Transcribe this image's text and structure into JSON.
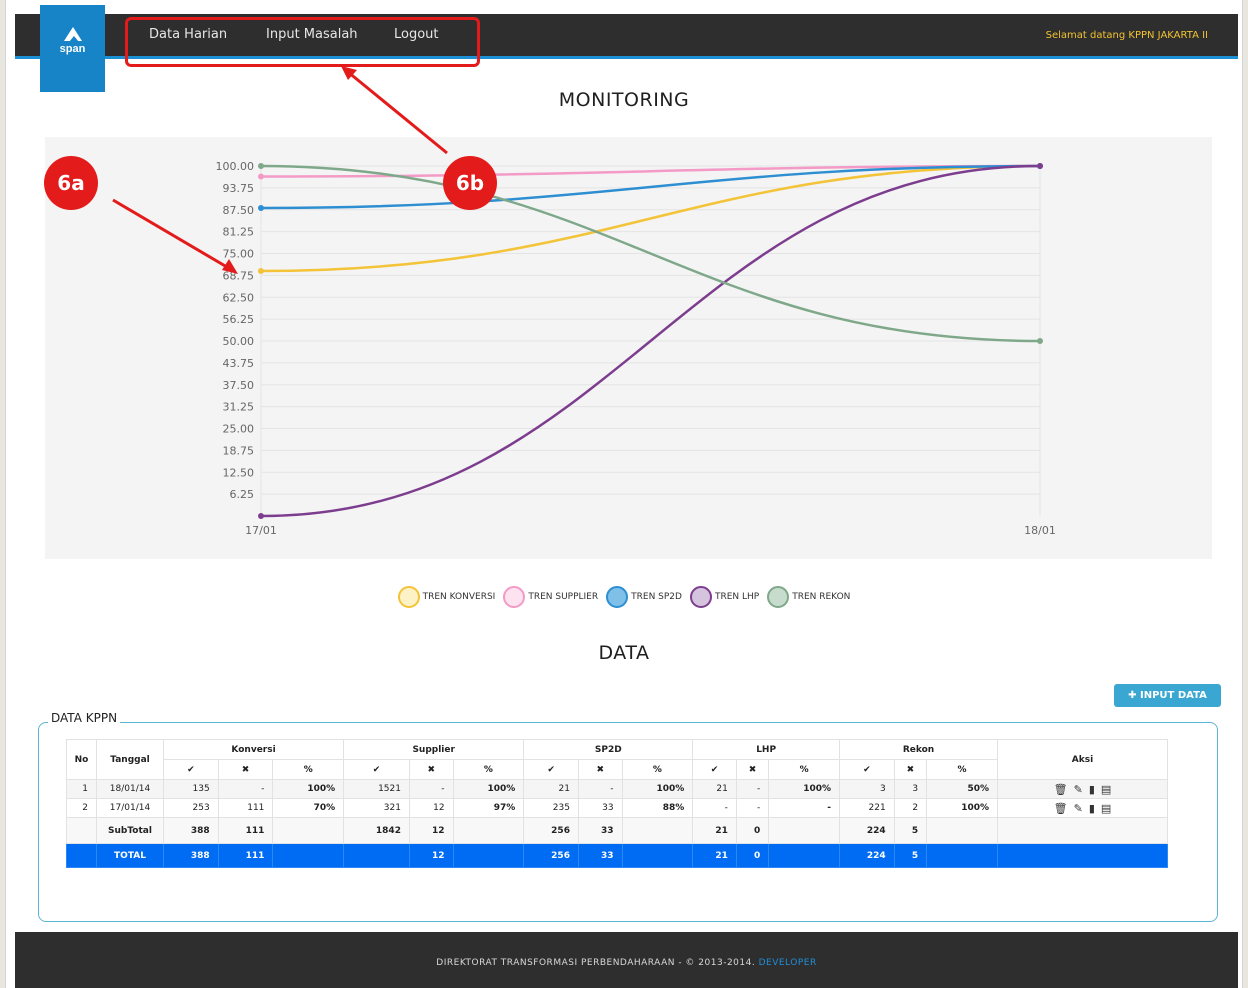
{
  "nav": {
    "logo_text": "span",
    "items": [
      {
        "label": "Data Harian"
      },
      {
        "label": "Input Masalah"
      },
      {
        "label": "Logout"
      }
    ],
    "welcome": "Selamat datang KPPN JAKARTA II"
  },
  "annotations": {
    "a": "6a",
    "b": "6b"
  },
  "headings": {
    "monitoring": "MONITORING",
    "data": "DATA"
  },
  "chart_data": {
    "type": "line",
    "x": [
      "17/01",
      "18/01"
    ],
    "ylim": [
      0,
      100
    ],
    "yticks": [
      "100.00",
      "93.75",
      "87.50",
      "81.25",
      "75.00",
      "68.75",
      "62.50",
      "56.25",
      "50.00",
      "43.75",
      "37.50",
      "31.25",
      "25.00",
      "18.75",
      "12.50",
      "6.25"
    ],
    "grid": true,
    "legend_position": "bottom",
    "series": [
      {
        "name": "TREN KONVERSI",
        "color": "#f3c338",
        "fill": "#fdf1c6",
        "values": [
          70,
          100
        ]
      },
      {
        "name": "TREN SUPPLIER",
        "color": "#f39ac6",
        "fill": "#fde3ef",
        "values": [
          97,
          100
        ]
      },
      {
        "name": "TREN SP2D",
        "color": "#2d8ed2",
        "fill": "#7fc0e8",
        "values": [
          88,
          100
        ]
      },
      {
        "name": "TREN LHP",
        "color": "#7d3d8f",
        "fill": "#d6c3de",
        "values": [
          0,
          100
        ]
      },
      {
        "name": "TREN REKON",
        "color": "#7fa88a",
        "fill": "#c8dccd",
        "values": [
          100,
          50
        ]
      }
    ]
  },
  "input_button": "INPUT DATA",
  "section_legend": "DATA KPPN",
  "table": {
    "headers": {
      "no": "No",
      "tanggal": "Tanggal",
      "aksi": "Aksi",
      "groups": [
        "Konversi",
        "Supplier",
        "SP2D",
        "LHP",
        "Rekon"
      ],
      "sub": [
        "✔",
        "✖",
        "%"
      ]
    },
    "rows": [
      {
        "no": "1",
        "tanggal": "18/01/14",
        "cells": [
          "135",
          "-",
          "100%",
          "1521",
          "-",
          "100%",
          "21",
          "-",
          "100%",
          "21",
          "-",
          "100%",
          "3",
          "3",
          "50%"
        ]
      },
      {
        "no": "2",
        "tanggal": "17/01/14",
        "cells": [
          "253",
          "111",
          "70%",
          "321",
          "12",
          "97%",
          "235",
          "33",
          "88%",
          "-",
          "-",
          "-",
          "221",
          "2",
          "100%"
        ]
      }
    ],
    "subtotal": {
      "label": "SubTotal",
      "cells": [
        "388",
        "111",
        "",
        "1842",
        "12",
        "",
        "256",
        "33",
        "",
        "21",
        "0",
        "",
        "224",
        "5",
        ""
      ]
    },
    "total": {
      "label": "TOTAL",
      "cells": [
        "388",
        "111",
        "",
        "",
        "12",
        "",
        "256",
        "33",
        "",
        "21",
        "0",
        "",
        "224",
        "5",
        ""
      ]
    }
  },
  "footer": {
    "text": "DIREKTORAT TRANSFORMASI PERBENDAHARAAN - © 2013-2014.",
    "link": "DEVELOPER"
  }
}
